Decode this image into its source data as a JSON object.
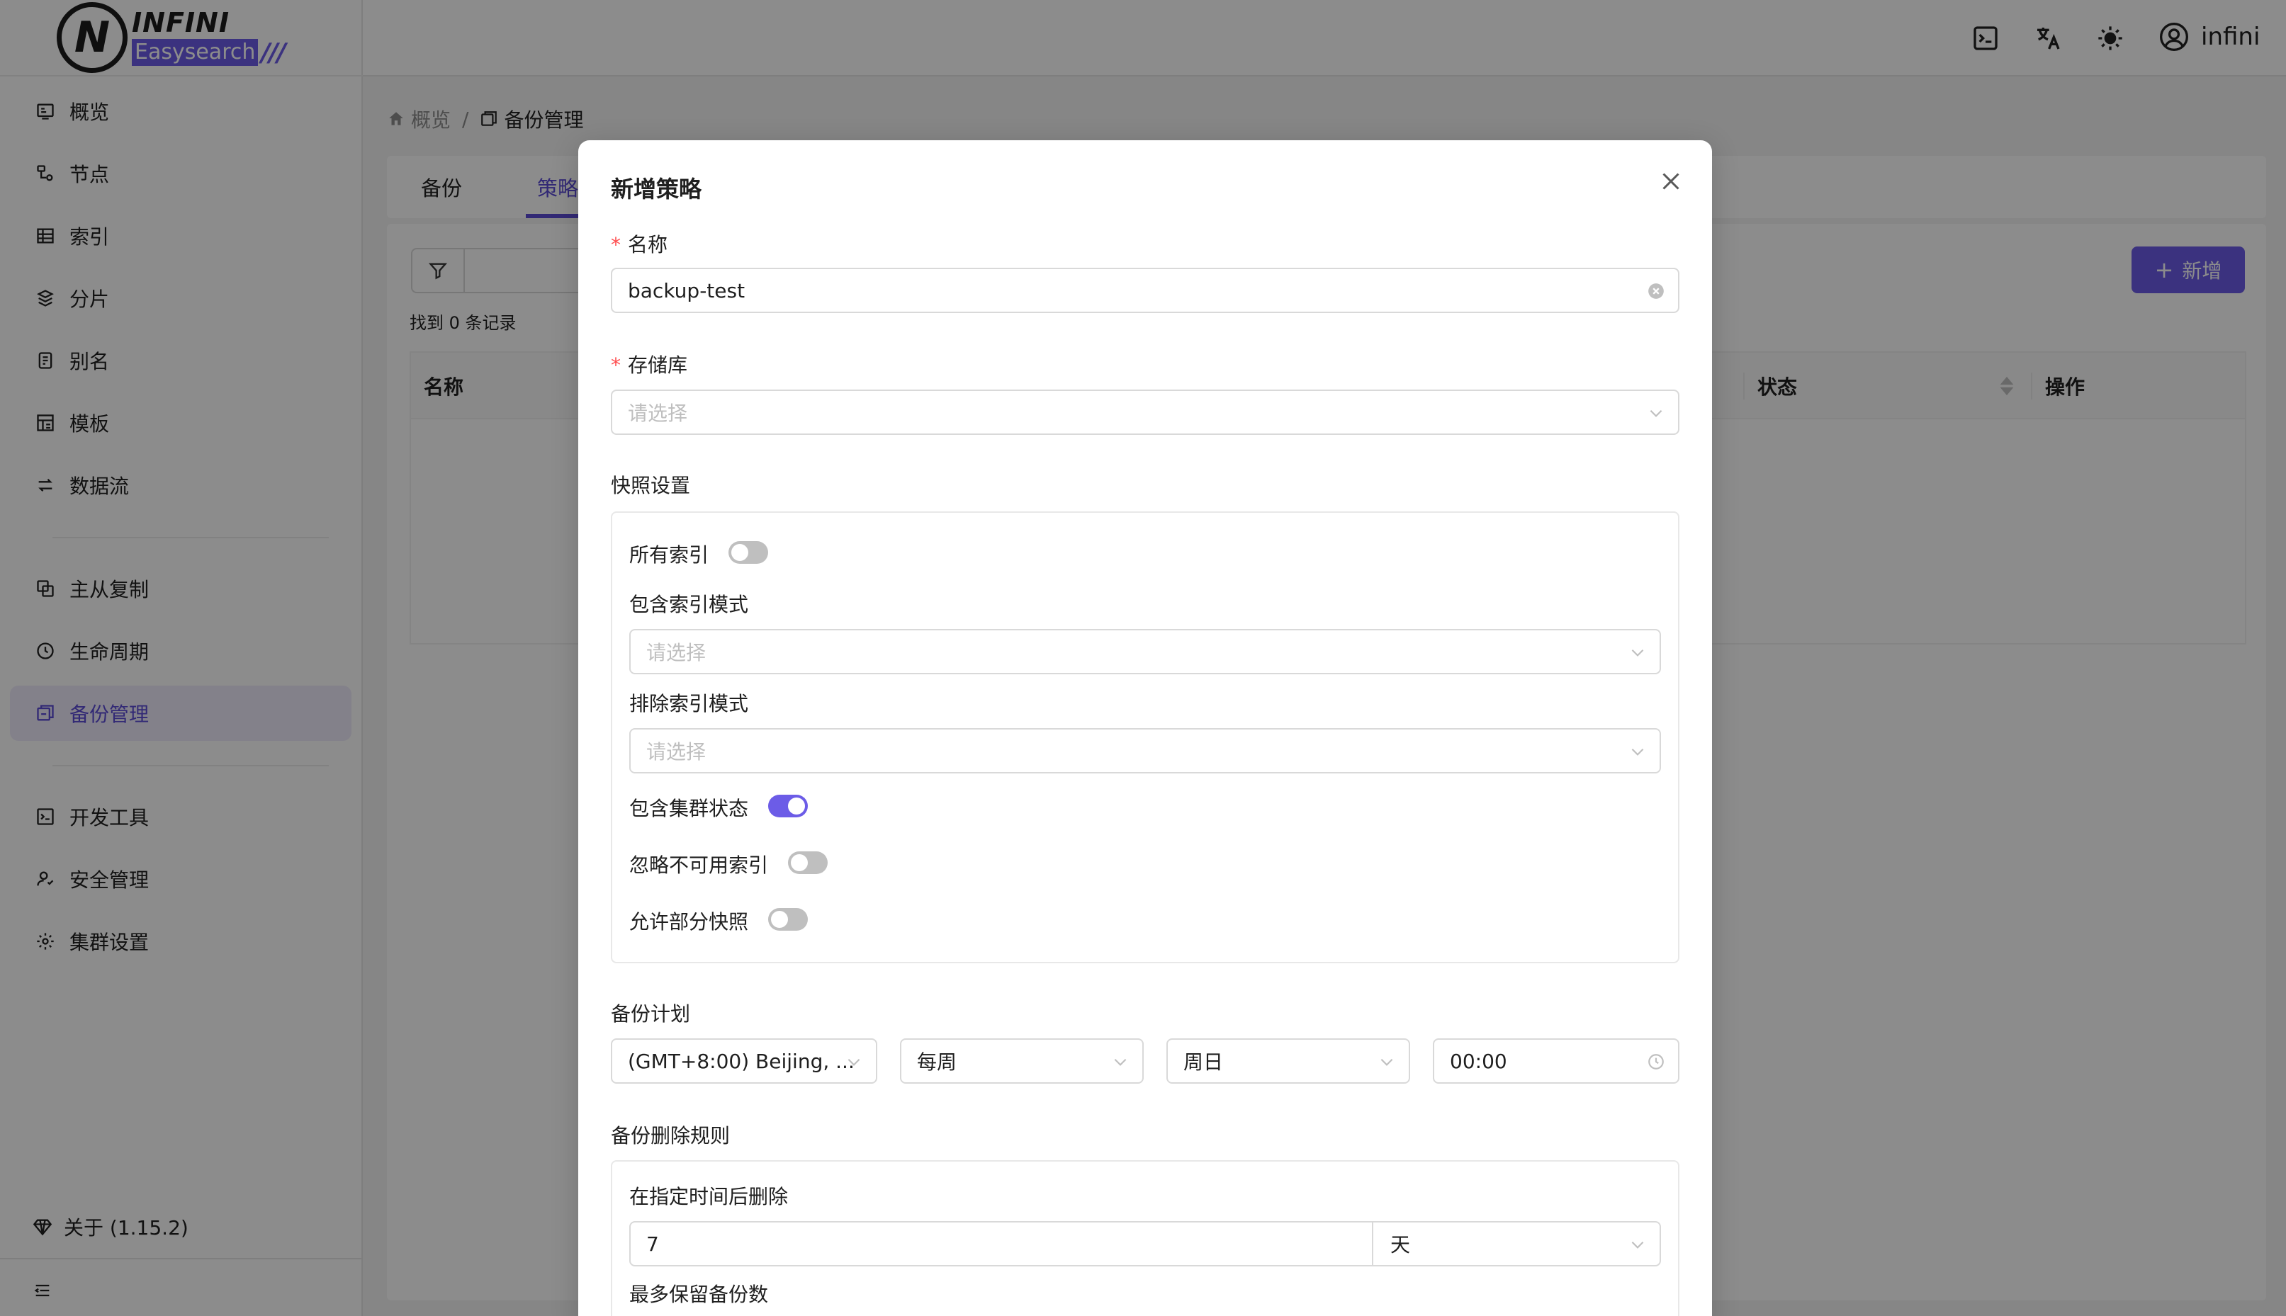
{
  "brand": {
    "top": "INFINI",
    "bottom": "Easysearch",
    "slashes": "///"
  },
  "sidebar": {
    "items": [
      {
        "label": "概览",
        "icon": "overview-icon"
      },
      {
        "label": "节点",
        "icon": "node-icon"
      },
      {
        "label": "索引",
        "icon": "index-icon"
      },
      {
        "label": "分片",
        "icon": "shard-icon"
      },
      {
        "label": "别名",
        "icon": "alias-icon"
      },
      {
        "label": "模板",
        "icon": "template-icon"
      },
      {
        "label": "数据流",
        "icon": "datastream-icon"
      },
      {
        "label": "主从复制",
        "icon": "replication-icon"
      },
      {
        "label": "生命周期",
        "icon": "lifecycle-icon"
      },
      {
        "label": "备份管理",
        "icon": "backup-icon",
        "active": true
      },
      {
        "label": "开发工具",
        "icon": "devtools-icon"
      },
      {
        "label": "安全管理",
        "icon": "security-icon"
      },
      {
        "label": "集群设置",
        "icon": "settings-icon"
      }
    ],
    "about": "关于 (1.15.2)"
  },
  "topbar": {
    "username": "infini"
  },
  "breadcrumb": {
    "home": "概览",
    "separator": "/",
    "current": "备份管理"
  },
  "tabs": [
    {
      "label": "备份"
    },
    {
      "label": "策略",
      "active": true
    }
  ],
  "toolbar": {
    "found_text": "找到 0 条记录",
    "add_label": "新增",
    "add_symbol": "+"
  },
  "table": {
    "columns": [
      "名称",
      "状态",
      "操作"
    ]
  },
  "modal": {
    "title": "新增策略",
    "name_label": "名称",
    "name_value": "backup-test",
    "repo_label": "存储库",
    "repo_placeholder": "请选择",
    "snapshot_label": "快照设置",
    "all_indices_label": "所有索引",
    "all_indices_on": false,
    "include_pattern_label": "包含索引模式",
    "include_pattern_placeholder": "请选择",
    "exclude_pattern_label": "排除索引模式",
    "exclude_pattern_placeholder": "请选择",
    "include_cluster_state_label": "包含集群状态",
    "include_cluster_state_on": true,
    "ignore_unavailable_label": "忽略不可用索引",
    "ignore_unavailable_on": false,
    "allow_partial_label": "允许部分快照",
    "allow_partial_on": false,
    "schedule_label": "备份计划",
    "timezone_value": "(GMT+8:00) Beijing, ...",
    "frequency_value": "每周",
    "weekday_value": "周日",
    "time_value": "00:00",
    "delete_rules_label": "备份删除规则",
    "delete_after_label": "在指定时间后删除",
    "delete_after_value": "7",
    "delete_after_unit": "天",
    "max_keep_label": "最多保留备份数"
  },
  "colors": {
    "accent": "#6c5ce7",
    "required": "#ff4d4f"
  }
}
